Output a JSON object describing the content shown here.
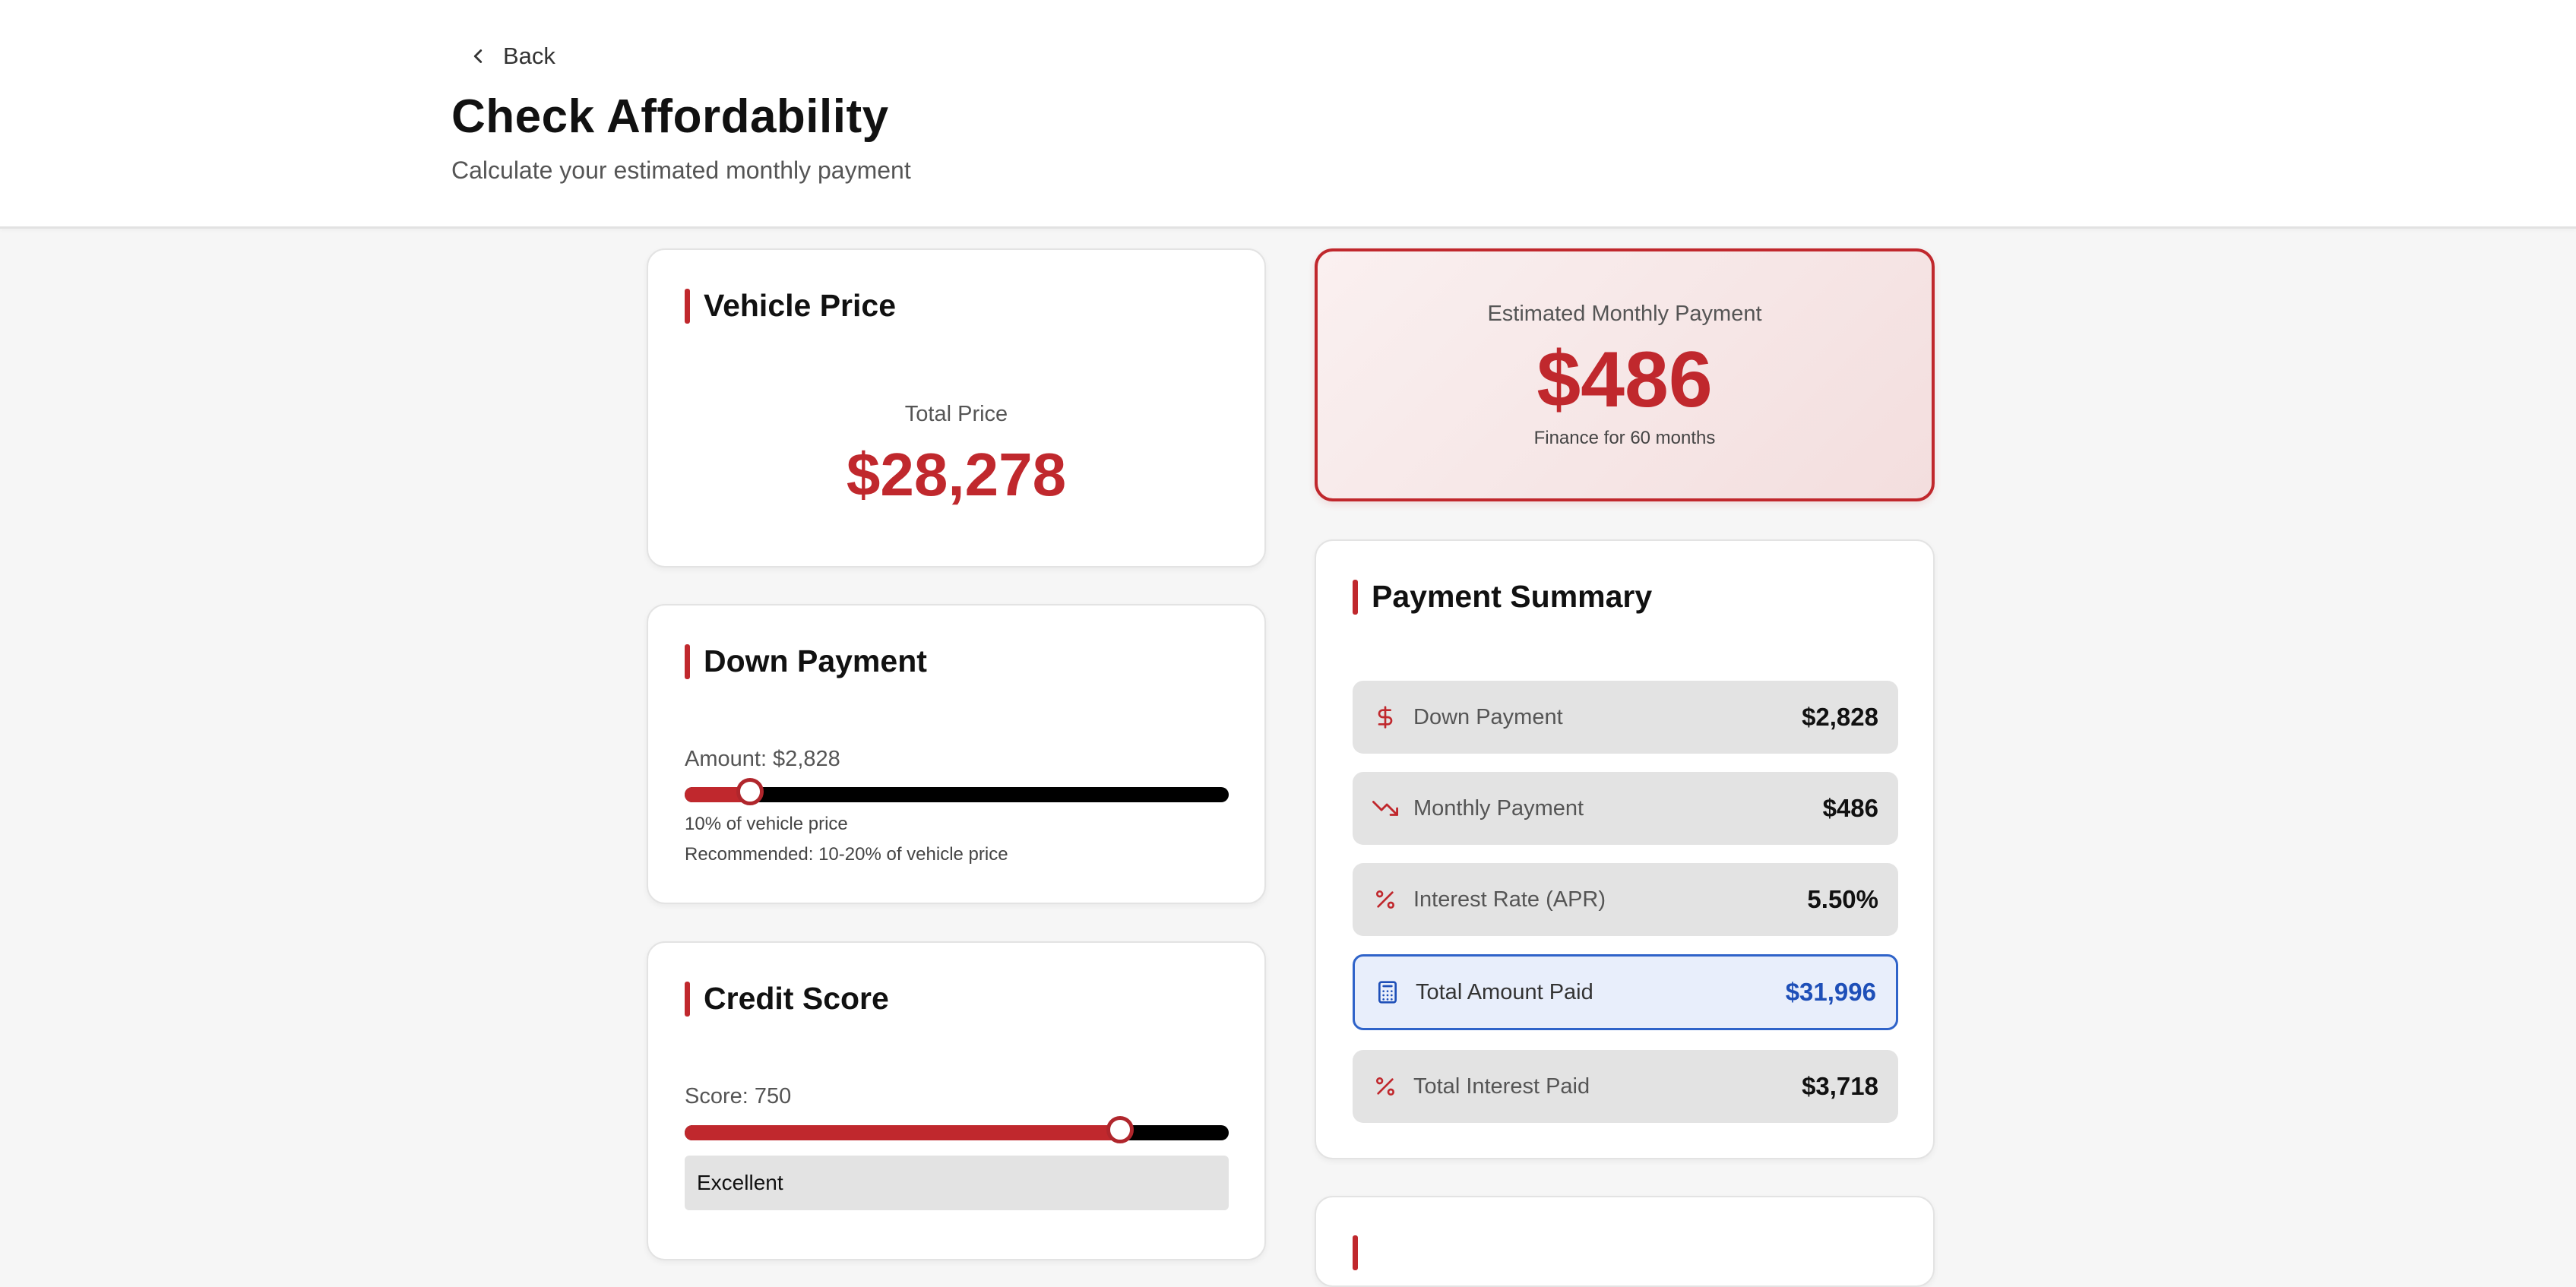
{
  "header": {
    "back_label": "Back",
    "title": "Check Affordability",
    "subtitle": "Calculate your estimated monthly payment"
  },
  "vehicle_price": {
    "title": "Vehicle Price",
    "total_label": "Total Price",
    "total_value": "$28,278"
  },
  "down_payment": {
    "title": "Down Payment",
    "amount_label": "Amount: $2,828",
    "percent_note": "10% of vehicle price",
    "recommendation": "Recommended: 10-20% of vehicle price",
    "slider_fraction": 0.12
  },
  "credit_score": {
    "title": "Credit Score",
    "score_label": "Score: 750",
    "rating": "Excellent",
    "slider_fraction": 0.8
  },
  "estimate": {
    "label": "Estimated Monthly Payment",
    "value": "$486",
    "term_note": "Finance for 60 months"
  },
  "summary": {
    "title": "Payment Summary",
    "rows": [
      {
        "icon": "dollar-icon",
        "label": "Down Payment",
        "value": "$2,828"
      },
      {
        "icon": "trending-down-icon",
        "label": "Monthly Payment",
        "value": "$486"
      },
      {
        "icon": "percent-icon",
        "label": "Interest Rate (APR)",
        "value": "5.50%"
      },
      {
        "icon": "calculator-icon",
        "label": "Total Amount Paid",
        "value": "$31,996"
      },
      {
        "icon": "percent-icon",
        "label": "Total Interest Paid",
        "value": "$3,718"
      }
    ]
  },
  "colors": {
    "accent": "#c0282d",
    "highlight_blue": "#1e4fb8",
    "estimate_bg": "#f6e4e4"
  }
}
